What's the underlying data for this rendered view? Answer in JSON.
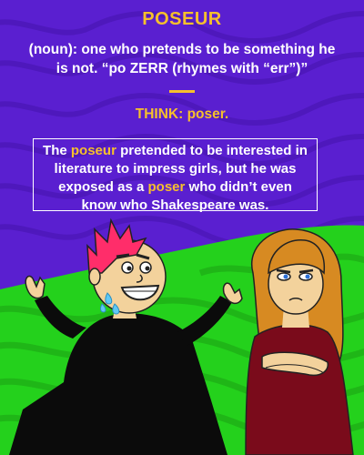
{
  "word": "POSEUR",
  "definition": "(noun): one who pretends to be something he is not. “po ZERR (rhymes with “err”)”",
  "think": {
    "prefix": "THINK:",
    "word": "poser."
  },
  "sentence": {
    "part1": "The ",
    "hl1": "poseur",
    "part2": " pretended to be interested in literature to impress girls, but he was exposed as a ",
    "hl2": "poser",
    "part3": " who didn’t even know who Shakespeare was."
  },
  "colors": {
    "background_top": "#5a1fd0",
    "background_bottom": "#24d11c",
    "accent": "#f6c02c",
    "text": "#ffffff"
  }
}
